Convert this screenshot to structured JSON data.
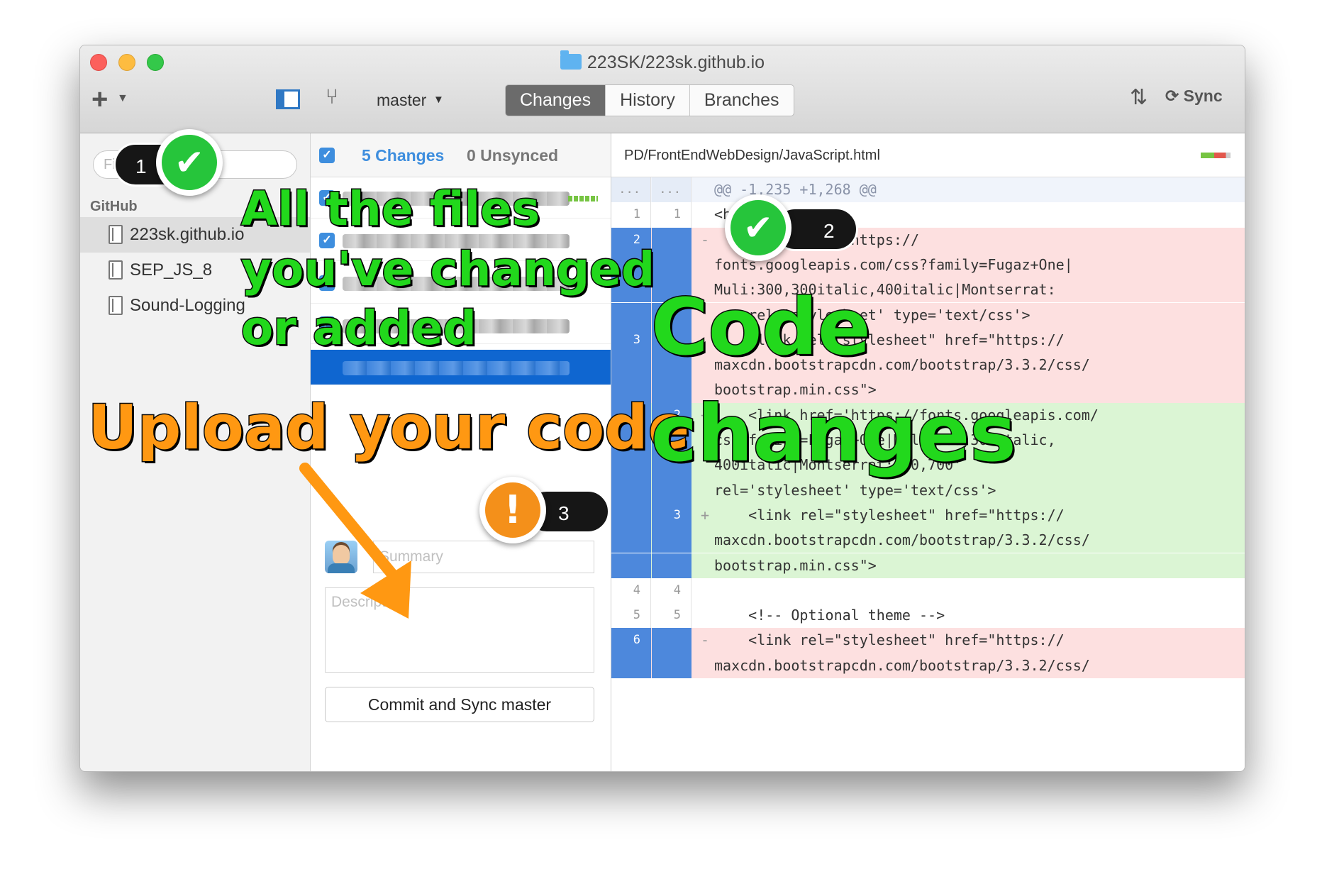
{
  "window": {
    "title": "223SK/223sk.github.io"
  },
  "toolbar": {
    "add_label": "+",
    "branch_name": "master",
    "tabs": [
      {
        "label": "Changes",
        "active": true
      },
      {
        "label": "History",
        "active": false
      },
      {
        "label": "Branches",
        "active": false
      }
    ],
    "sync_label": "Sync"
  },
  "sidebar": {
    "filter_placeholder": "Filter Repositories",
    "section_label": "GitHub",
    "repos": [
      {
        "name": "223sk.github.io",
        "selected": true
      },
      {
        "name": "SEP_JS_8",
        "selected": false
      },
      {
        "name": "Sound-Logging",
        "selected": false
      }
    ]
  },
  "changes_panel": {
    "changes_count": "5 Changes",
    "unsynced_count": "0 Unsynced",
    "summary_placeholder": "Summary",
    "description_placeholder": "Description",
    "commit_button": "Commit and Sync master"
  },
  "diff": {
    "file_path": "PD/FrontEndWebDesign/JavaScript.html",
    "lines": [
      {
        "type": "hunk",
        "old": "...",
        "new": "...",
        "sign": "",
        "text": "@@ -1,235 +1,268 @@"
      },
      {
        "type": "ctx",
        "old": "1",
        "new": "1",
        "sign": "",
        "text": "<head>"
      },
      {
        "type": "del",
        "old": "2",
        "new": "",
        "sign": "-",
        "text": "    <link href='https://"
      },
      {
        "type": "del",
        "old": "",
        "new": "",
        "sign": "",
        "text": "fonts.googleapis.com/css?family=Fugaz+One|"
      },
      {
        "type": "del",
        "old": "",
        "new": "",
        "sign": "",
        "text": "Muli:300,300italic,400italic|Montserrat:"
      },
      {
        "type": "del",
        "old": "",
        "new": "",
        "sign": "",
        "text": "    rel='stylesheet' type='text/css'>"
      },
      {
        "type": "del",
        "old": "3",
        "new": "",
        "sign": "",
        "text": "    <link rel=\"stylesheet\" href=\"https://"
      },
      {
        "type": "del",
        "old": "",
        "new": "",
        "sign": "",
        "text": "maxcdn.bootstrapcdn.com/bootstrap/3.3.2/css/"
      },
      {
        "type": "del",
        "old": "",
        "new": "",
        "sign": "",
        "text": "bootstrap.min.css\">"
      },
      {
        "type": "add",
        "old": "",
        "new": "2",
        "sign": "+",
        "text": "    <link href='https://fonts.googleapis.com/"
      },
      {
        "type": "add",
        "old": "",
        "new": "",
        "sign": "",
        "text": "css?family=Fugaz+One|Muli:300,300italic,"
      },
      {
        "type": "add",
        "old": "",
        "new": "",
        "sign": "",
        "text": "400italic|Montserrat:400,700'"
      },
      {
        "type": "add",
        "old": "",
        "new": "",
        "sign": "",
        "text": "rel='stylesheet' type='text/css'>"
      },
      {
        "type": "add",
        "old": "",
        "new": "3",
        "sign": "+",
        "text": "    <link rel=\"stylesheet\" href=\"https://"
      },
      {
        "type": "add",
        "old": "",
        "new": "",
        "sign": "",
        "text": "maxcdn.bootstrapcdn.com/bootstrap/3.3.2/css/"
      },
      {
        "type": "add",
        "old": "",
        "new": "",
        "sign": "",
        "text": "bootstrap.min.css\">"
      },
      {
        "type": "ctx",
        "old": "4",
        "new": "4",
        "sign": "",
        "text": ""
      },
      {
        "type": "ctx",
        "old": "5",
        "new": "5",
        "sign": "",
        "text": "    <!-- Optional theme -->"
      },
      {
        "type": "del",
        "old": "6",
        "new": "",
        "sign": "-",
        "text": "    <link rel=\"stylesheet\" href=\"https://"
      },
      {
        "type": "del",
        "old": "",
        "new": "",
        "sign": "",
        "text": "maxcdn.bootstrapcdn.com/bootstrap/3.3.2/css/"
      }
    ]
  },
  "annotations": {
    "badge_1": "1",
    "badge_2": "2",
    "badge_3": "3",
    "files_line1": "All the files",
    "files_line2": "you've changed",
    "files_line3": "or added",
    "upload": "Upload your code",
    "code_line1": "Code",
    "code_line2": "changes",
    "check_glyph": "✔",
    "warn_glyph": "!"
  },
  "colors": {
    "accent_blue": "#3e8ede",
    "overlay_green": "#22d81c",
    "overlay_orange": "#ff9812"
  }
}
